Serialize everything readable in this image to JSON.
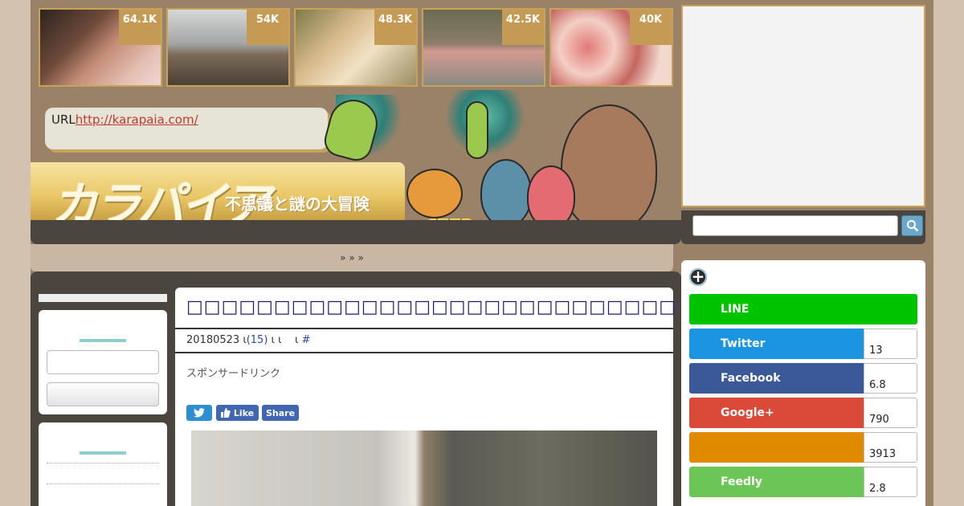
{
  "header": {
    "thumbnails": [
      {
        "count": "64.1K"
      },
      {
        "count": "54K"
      },
      {
        "count": "48.3K"
      },
      {
        "count": "42.5K"
      },
      {
        "count": "40K"
      }
    ],
    "url_prefix": "URL",
    "url_link": "http://karapaia.com/",
    "logo_text": "カラパイア",
    "tagline": "不思議と謎の大冒険"
  },
  "breadcrumb": {
    "text": "» »   »"
  },
  "article": {
    "title": "□□□□□□□□□□□□□□□□□□□□□□□□□□□□",
    "date": "20180523",
    "sep1": "ι",
    "comments": "(15)",
    "sep2": "ι ι",
    "sep3": "ι",
    "hash": "#",
    "sponsor": "スポンサードリンク",
    "like_label": "Like",
    "share_label": "Share"
  },
  "social": {
    "rows": [
      {
        "label": "LINE",
        "count": "",
        "color": "#00c300"
      },
      {
        "label": "Twitter",
        "count": "13",
        "color": "#1b95e0"
      },
      {
        "label": "Facebook",
        "count": "6.8",
        "color": "#3b5998"
      },
      {
        "label": "Google+",
        "count": "790",
        "color": "#db4a39"
      },
      {
        "label": "",
        "count": "3913",
        "color": "#e08a00"
      },
      {
        "label": "Feedly",
        "count": "2.8",
        "color": "#6cc655"
      }
    ]
  }
}
